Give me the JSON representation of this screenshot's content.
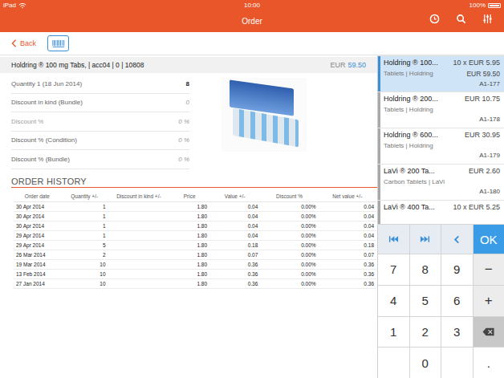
{
  "status_bar": {
    "carrier": "iPad",
    "time": "10:00",
    "battery": "100%",
    "battery_level": 1
  },
  "header": {
    "title": "Order"
  },
  "toolbar": {
    "back": "Back"
  },
  "product": {
    "title": "Holdring ® 100 mg Tabs, | acc04 | 0 | 10808",
    "currency": "EUR",
    "total": "59.50"
  },
  "fields": [
    {
      "label": "Quantity 1 (18 Jun 2014)",
      "value": "8",
      "emphasized": true,
      "disabled": false
    },
    {
      "label": "Discount in kind (Bundle)",
      "value": "0",
      "emphasized": false,
      "disabled": false
    },
    {
      "label": "Discount %",
      "value": "0 %",
      "emphasized": false,
      "disabled": true
    },
    {
      "label": "Discount % (Condition)",
      "value": "0 %",
      "emphasized": false,
      "disabled": false
    },
    {
      "label": "Discount % (Bundle)",
      "value": "0 %",
      "emphasized": false,
      "disabled": false
    }
  ],
  "history": {
    "title": "ORDER HISTORY",
    "columns": [
      "Order date",
      "Quantity +/-",
      "Discount in kind +/-",
      "Price",
      "Value +/-",
      "Discount %",
      "Net value +/-"
    ],
    "rows": [
      [
        "30 Apr 2014",
        "1",
        "",
        "1.80",
        "0.04",
        "0.00%",
        "0.04"
      ],
      [
        "30 Apr 2014",
        "1",
        "",
        "1.80",
        "0.04",
        "0.00%",
        "0.04"
      ],
      [
        "30 Apr 2014",
        "1",
        "",
        "1.80",
        "0.04",
        "0.00%",
        "0.04"
      ],
      [
        "29 Apr 2014",
        "1",
        "",
        "1.80",
        "0.04",
        "0.00%",
        "0.04"
      ],
      [
        "29 Apr 2014",
        "5",
        "",
        "1.80",
        "0.18",
        "0.00%",
        "0.18"
      ],
      [
        "26 Mar 2014",
        "2",
        "",
        "1.80",
        "0.07",
        "0.00%",
        "0.07"
      ],
      [
        "19 Mar 2014",
        "10",
        "",
        "1.80",
        "0.36",
        "0.00%",
        "0.36"
      ],
      [
        "13 Feb 2014",
        "10",
        "",
        "1.80",
        "0.36",
        "0.00%",
        "0.36"
      ],
      [
        "27 Jan 2014",
        "10",
        "",
        "1.80",
        "0.36",
        "0.00%",
        "0.36"
      ]
    ]
  },
  "list": {
    "items": [
      {
        "name": "Holdring ® 100...",
        "price": "10 x EUR 5.95",
        "category": "Tablets | Holdring",
        "total": "EUR 59.50",
        "code": "A1-177",
        "selected": true
      },
      {
        "name": "Holdring ® 200...",
        "price": "EUR 10.75",
        "category": "Tablets | Holdring",
        "total": "",
        "code": "A1-178",
        "selected": false
      },
      {
        "name": "Holdring ® 600...",
        "price": "EUR 30.95",
        "category": "Tablets | Holdring",
        "total": "",
        "code": "A1-179",
        "selected": false
      },
      {
        "name": "LaVi ® 200 Ta...",
        "price": "EUR 2.60",
        "category": "Carbon Tablets  | LaVi",
        "total": "",
        "code": "A1-180",
        "selected": false
      },
      {
        "name": "LaVi ® 400 Ta...",
        "price": "10 x EUR 5.25",
        "category": "",
        "total": "",
        "code": "",
        "selected": false
      }
    ]
  },
  "keypad": {
    "keys": [
      {
        "kind": "first",
        "label": ""
      },
      {
        "kind": "last",
        "label": ""
      },
      {
        "kind": "back",
        "label": ""
      },
      {
        "kind": "ok",
        "label": "OK"
      },
      {
        "kind": "digit",
        "label": "7"
      },
      {
        "kind": "digit",
        "label": "8"
      },
      {
        "kind": "digit",
        "label": "9"
      },
      {
        "kind": "op",
        "label": "−"
      },
      {
        "kind": "digit",
        "label": "4"
      },
      {
        "kind": "digit",
        "label": "5"
      },
      {
        "kind": "digit",
        "label": "6"
      },
      {
        "kind": "op",
        "label": "+"
      },
      {
        "kind": "digit",
        "label": "1"
      },
      {
        "kind": "digit",
        "label": "2"
      },
      {
        "kind": "digit",
        "label": "3"
      },
      {
        "kind": "delete",
        "label": ""
      },
      {
        "kind": "blank",
        "label": ""
      },
      {
        "kind": "digit",
        "label": "0"
      },
      {
        "kind": "blank",
        "label": ""
      },
      {
        "kind": "digit",
        "label": "."
      }
    ]
  }
}
